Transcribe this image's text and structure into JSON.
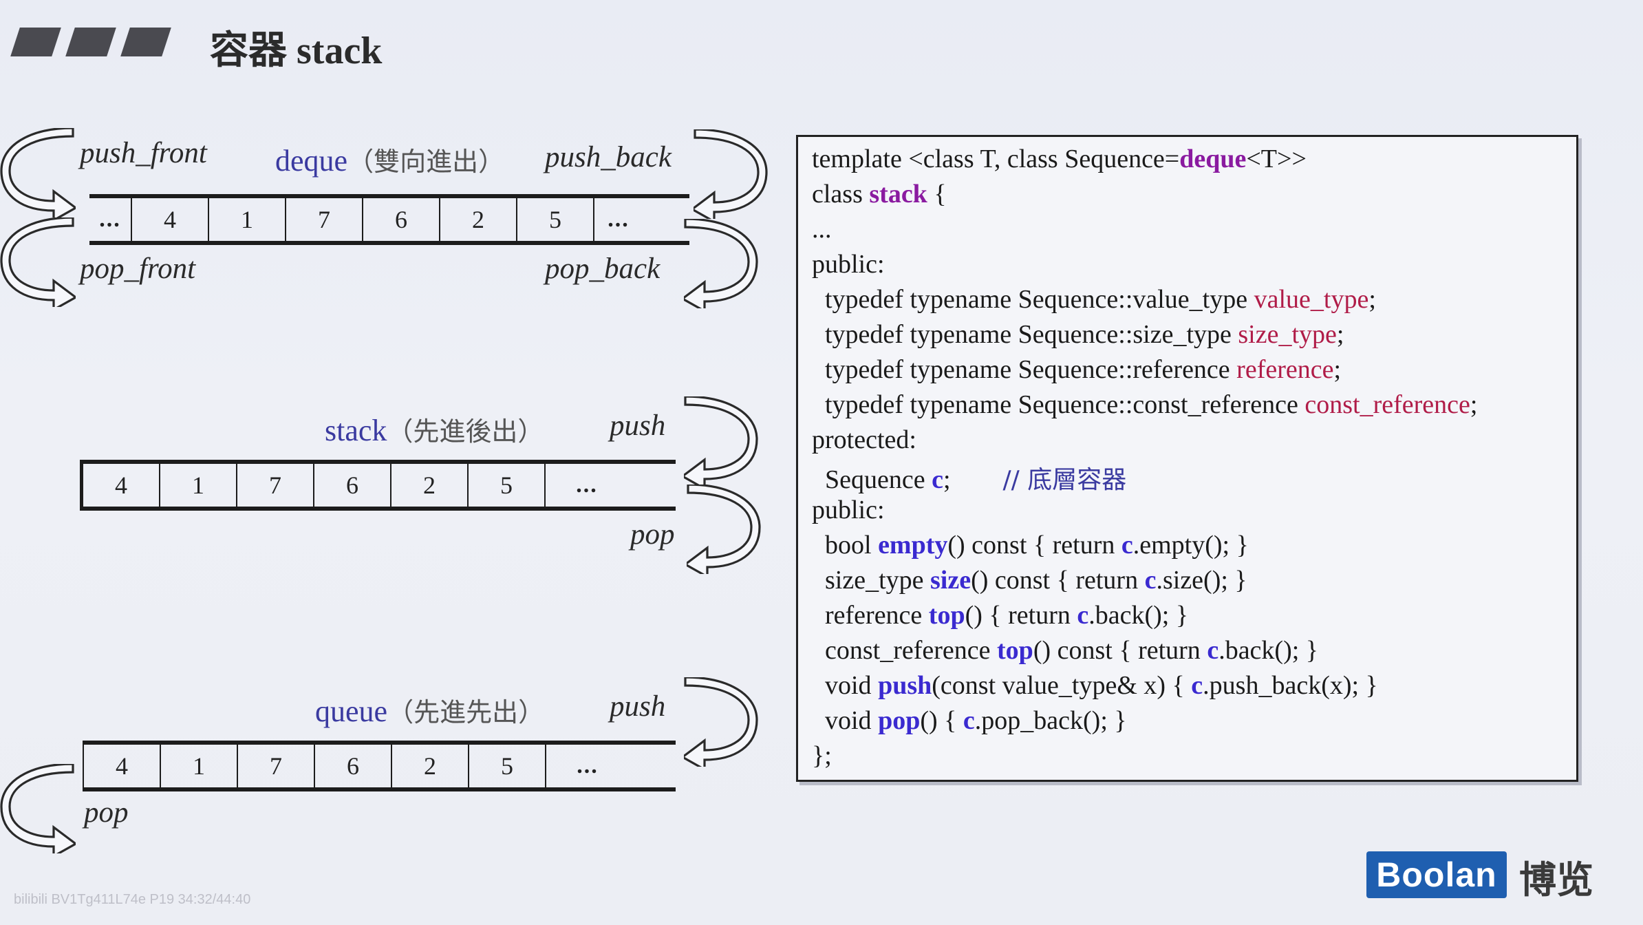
{
  "title": "容器 stack",
  "deque": {
    "name": "deque",
    "desc": "（雙向進出）",
    "push_front": "push_front",
    "push_back": "push_back",
    "pop_front": "pop_front",
    "pop_back": "pop_back",
    "cells": [
      "...",
      "4",
      "1",
      "7",
      "6",
      "2",
      "5",
      "..."
    ]
  },
  "stack": {
    "name": "stack",
    "desc": "（先進後出）",
    "push": "push",
    "pop": "pop",
    "cells": [
      "4",
      "1",
      "7",
      "6",
      "2",
      "5",
      "..."
    ]
  },
  "queue": {
    "name": "queue",
    "desc": "（先進先出）",
    "push": "push",
    "pop": "pop",
    "cells": [
      "4",
      "1",
      "7",
      "6",
      "2",
      "5",
      "..."
    ]
  },
  "code": {
    "l1_a": "template <class T, class Sequence=",
    "l1_kw": "deque",
    "l1_b": "<T>>",
    "l2_a": "class ",
    "l2_kw": "stack",
    "l2_b": " {",
    "l3": "...",
    "l4": "public:",
    "l5_a": "  typedef typename Sequence::value_type ",
    "l5_kw": "value_type",
    "l5_b": ";",
    "l6_a": "  typedef typename Sequence::size_type ",
    "l6_kw": "size_type",
    "l6_b": ";",
    "l7_a": "  typedef typename Sequence::reference ",
    "l7_kw": "reference",
    "l7_b": ";",
    "l8_a": "  typedef typename Sequence::const_reference ",
    "l8_kw": "const_reference",
    "l8_b": ";",
    "l9": "protected:",
    "l10_a": "  Sequence ",
    "l10_kw": "c",
    "l10_b": ";",
    "l10_cmt": "// 底層容器",
    "l11": "public:",
    "l12_a": "  bool ",
    "l12_kw": "empty",
    "l12_b": "() const { return ",
    "l12_c": "c",
    "l12_d": ".empty(); }",
    "l13_a": "  size_type ",
    "l13_kw": "size",
    "l13_b": "() const { return ",
    "l13_c": "c",
    "l13_d": ".size(); }",
    "l14_a": "  reference ",
    "l14_kw": "top",
    "l14_b": "() { return ",
    "l14_c": "c",
    "l14_d": ".back(); }",
    "l15_a": "  const_reference ",
    "l15_kw": "top",
    "l15_b": "() const { return ",
    "l15_c": "c",
    "l15_d": ".back(); }",
    "l16_a": "  void ",
    "l16_kw": "push",
    "l16_b": "(const value_type& x) { ",
    "l16_c": "c",
    "l16_d": ".push_back(x); }",
    "l17_a": "  void ",
    "l17_kw": "pop",
    "l17_b": "() { ",
    "l17_c": "c",
    "l17_d": ".pop_back(); }",
    "l18": "};"
  },
  "brand": {
    "logo": "Boolan",
    "cjk": "博览"
  },
  "watermark": "bilibili  BV1Tg411L74e  P19  34:32/44:40"
}
